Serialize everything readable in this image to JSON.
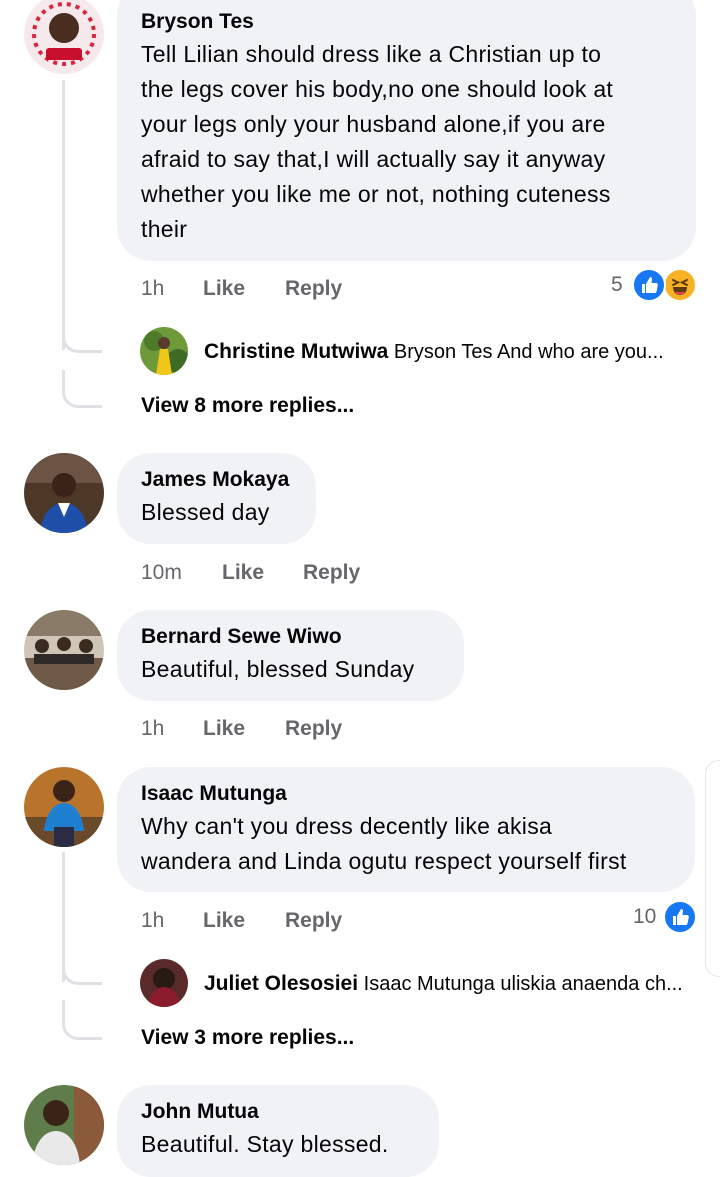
{
  "comments": [
    {
      "author": "Bryson Tes",
      "text_lines": [
        "Tell Lilian should dress like a Christian up to",
        "the legs cover his body,no one should look at",
        "your legs only your husband alone,if you are",
        "afraid to say that,I will actually say it anyway",
        "whether you like me or not, nothing cuteness",
        "their"
      ],
      "time": "1h",
      "like_label": "Like",
      "reply_label": "Reply",
      "reaction_count": "5",
      "reactions": [
        "like-icon",
        "haha-icon"
      ],
      "reply_preview": {
        "author": "Christine Mutwiwa",
        "text": "Bryson Tes And who are you..."
      },
      "more_replies": "View 8 more replies..."
    },
    {
      "author": "James Mokaya",
      "text": "Blessed day",
      "time": "10m",
      "like_label": "Like",
      "reply_label": "Reply"
    },
    {
      "author": "Bernard Sewe Wiwo",
      "text": "Beautiful, blessed Sunday",
      "time": "1h",
      "like_label": "Like",
      "reply_label": "Reply"
    },
    {
      "author": "Isaac Mutunga",
      "text_lines": [
        "Why can't you dress decently like akisa",
        "wandera and Linda ogutu respect yourself first"
      ],
      "time": "1h",
      "like_label": "Like",
      "reply_label": "Reply",
      "reaction_count": "10",
      "reactions": [
        "like-icon"
      ],
      "reply_preview": {
        "author": "Juliet Olesosiei",
        "text": "Isaac Mutunga uliskia anaenda ch..."
      },
      "more_replies": "View 3 more replies..."
    },
    {
      "author": "John Mutua",
      "text": "Beautiful. Stay blessed."
    }
  ],
  "colors": {
    "bubble": "#f0f2f5",
    "meta_text": "#65676b",
    "like_blue": "#1877f2",
    "haha_yellow": "#f7b125",
    "thread_line": "#dfe1e5"
  }
}
